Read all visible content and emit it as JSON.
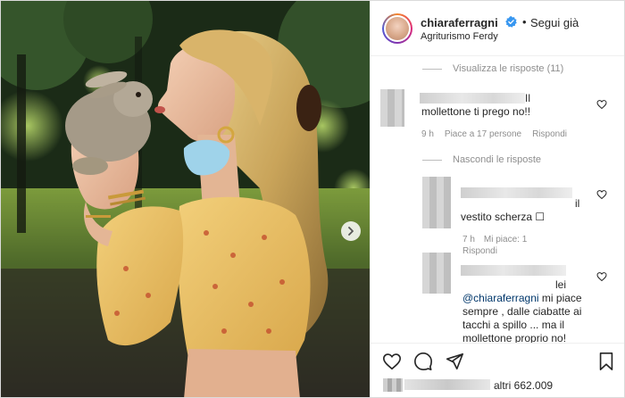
{
  "header": {
    "username": "chiaraferragni",
    "follow_dot": "•",
    "follow_label": "Segui già",
    "location": "Agriturismo Ferdy"
  },
  "comments": {
    "view_replies_label": "Visualizza le risposte (11)",
    "comment1": {
      "text": "Il mollettone ti prego no!!",
      "time": "9 h",
      "likes": "Piace a 17 persone",
      "reply_label": "Rispondi"
    },
    "hide_replies_label": "Nascondi le risposte",
    "reply1": {
      "text": "il vestito scherza ☐",
      "time": "7 h",
      "likes": "Mi piace: 1",
      "reply_label": "Rispondi"
    },
    "reply2": {
      "prefix": "lei",
      "mention": "@chiaraferragni",
      "text": " mi piace sempre , dalle ciabatte ai tacchi a spillo ... ma il mollettone proprio no!"
    }
  },
  "likes": {
    "others": "altri 662.009"
  },
  "icons": {
    "verified": "verified-badge-icon",
    "heart": "heart-icon",
    "comment": "comment-icon",
    "share": "share-icon",
    "bookmark": "bookmark-icon",
    "next": "chevron-right-icon"
  },
  "colors": {
    "verified_blue": "#3897f0",
    "muted_text": "#8e8e8e",
    "mention_blue": "#00376b",
    "dress_yellow": "#e9c268"
  }
}
